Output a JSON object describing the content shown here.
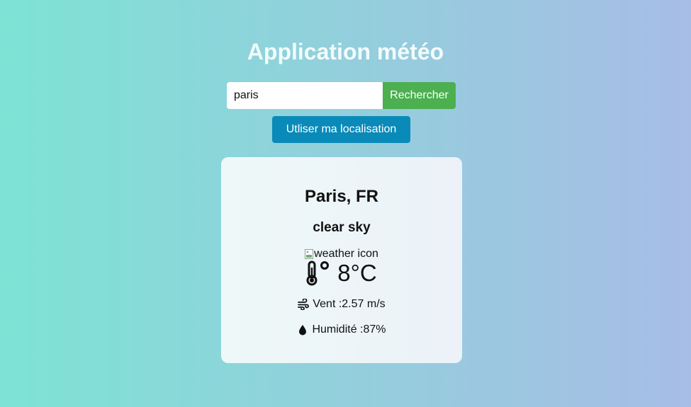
{
  "app": {
    "title": "Application météo"
  },
  "search": {
    "value": "paris",
    "button_label": "Rechercher"
  },
  "location": {
    "button_label": "Utliser ma localisation"
  },
  "weather": {
    "city": "Paris, FR",
    "description": "clear sky",
    "icon_alt": "weather icon",
    "temperature": "8°C",
    "wind": "Vent :2.57 m/s",
    "humidity": "Humidité :87%"
  },
  "colors": {
    "search_button": "#4caf50",
    "location_button": "#0a8ab8"
  },
  "icons": [
    "thermometer-icon",
    "wind-icon",
    "droplet-icon",
    "broken-image-icon"
  ]
}
